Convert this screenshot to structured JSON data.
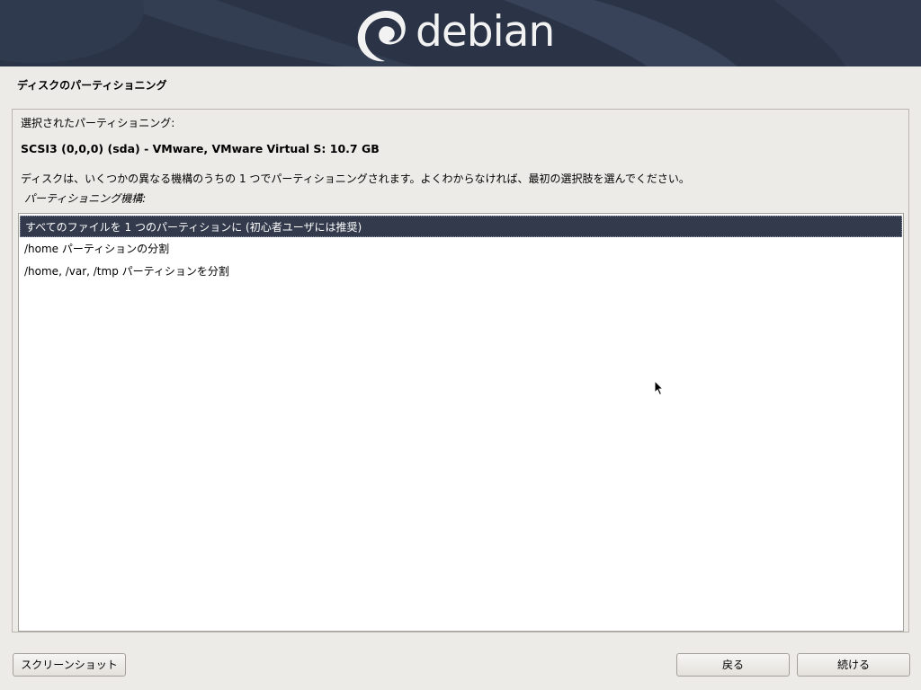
{
  "banner": {
    "logo_text": "debian",
    "logo_icon": "debian-swirl-icon",
    "background_color": "#2b3447"
  },
  "page": {
    "title": "ディスクのパーティショニング"
  },
  "content": {
    "selected_label": "選択されたパーティショニング:",
    "disk_name": "SCSI3 (0,0,0) (sda) - VMware, VMware Virtual S: 10.7 GB",
    "description": "ディスクは、いくつかの異なる機構のうちの 1 つでパーティショニングされます。よくわからなければ、最初の選択肢を選んでください。",
    "scheme_label": "パーティショニング機構:",
    "options": [
      {
        "label": "すべてのファイルを 1 つのパーティションに (初心者ユーザには推奨)",
        "selected": true
      },
      {
        "label": "/home パーティションの分割",
        "selected": false
      },
      {
        "label": "/home, /var, /tmp パーティションを分割",
        "selected": false
      }
    ],
    "selection_color": "#323a4b"
  },
  "buttons": {
    "screenshot": "スクリーンショット",
    "back": "戻る",
    "continue": "続ける"
  }
}
